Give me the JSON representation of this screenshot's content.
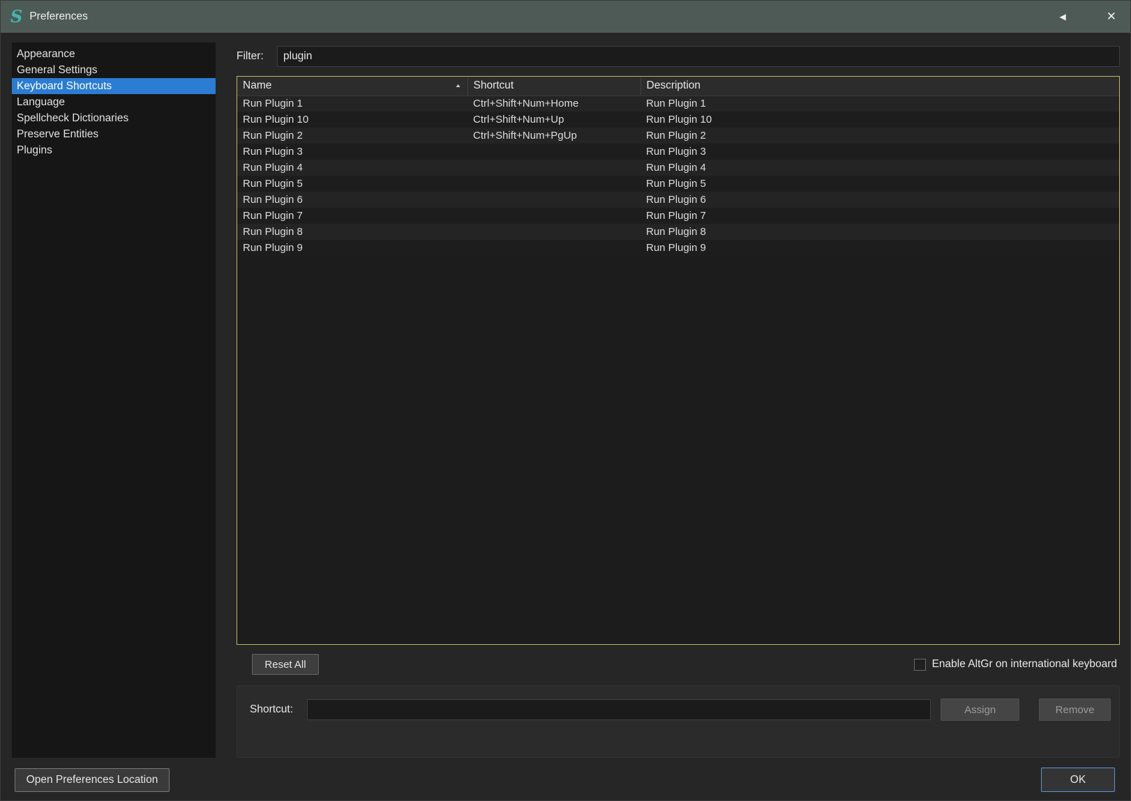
{
  "window": {
    "title": "Preferences"
  },
  "sidebar": {
    "items": [
      {
        "label": "Appearance",
        "selected": false
      },
      {
        "label": "General Settings",
        "selected": false
      },
      {
        "label": "Keyboard Shortcuts",
        "selected": true
      },
      {
        "label": "Language",
        "selected": false
      },
      {
        "label": "Spellcheck Dictionaries",
        "selected": false
      },
      {
        "label": "Preserve Entities",
        "selected": false
      },
      {
        "label": "Plugins",
        "selected": false
      }
    ]
  },
  "filter": {
    "label": "Filter:",
    "value": "plugin"
  },
  "table": {
    "columns": [
      "Name",
      "Shortcut",
      "Description"
    ],
    "sort": {
      "column": "Name",
      "direction": "ascending"
    },
    "rows": [
      {
        "name": "Run Plugin 1",
        "shortcut": "Ctrl+Shift+Num+Home",
        "description": "Run Plugin 1"
      },
      {
        "name": "Run Plugin 10",
        "shortcut": "Ctrl+Shift+Num+Up",
        "description": "Run Plugin 10"
      },
      {
        "name": "Run Plugin 2",
        "shortcut": "Ctrl+Shift+Num+PgUp",
        "description": "Run Plugin 2"
      },
      {
        "name": "Run Plugin 3",
        "shortcut": "",
        "description": "Run Plugin 3"
      },
      {
        "name": "Run Plugin 4",
        "shortcut": "",
        "description": "Run Plugin 4"
      },
      {
        "name": "Run Plugin 5",
        "shortcut": "",
        "description": "Run Plugin 5"
      },
      {
        "name": "Run Plugin 6",
        "shortcut": "",
        "description": "Run Plugin 6"
      },
      {
        "name": "Run Plugin 7",
        "shortcut": "",
        "description": "Run Plugin 7"
      },
      {
        "name": "Run Plugin 8",
        "shortcut": "",
        "description": "Run Plugin 8"
      },
      {
        "name": "Run Plugin 9",
        "shortcut": "",
        "description": "Run Plugin 9"
      }
    ]
  },
  "actions": {
    "reset_all": "Reset All"
  },
  "altgr": {
    "label": "Enable AltGr on international keyboard",
    "checked": false
  },
  "shortcut_panel": {
    "label": "Shortcut:",
    "value": "",
    "assign": "Assign",
    "remove": "Remove"
  },
  "footer": {
    "open_location": "Open Preferences Location",
    "ok": "OK"
  },
  "icons": {
    "logo": "sigil-s-icon",
    "titlebar_back": "arrow-left-icon",
    "titlebar_close": "close-icon",
    "sort": "sort-ascending-icon"
  },
  "colors": {
    "titlebar": "#4e5a55",
    "window-bg": "#262626",
    "sidebar-bg": "#161616",
    "selection": "#2b7cd3",
    "table-focus-border": "#b9b95a",
    "accent-ok-border": "#5a95d5",
    "logo-teal": "#3fb8af"
  }
}
